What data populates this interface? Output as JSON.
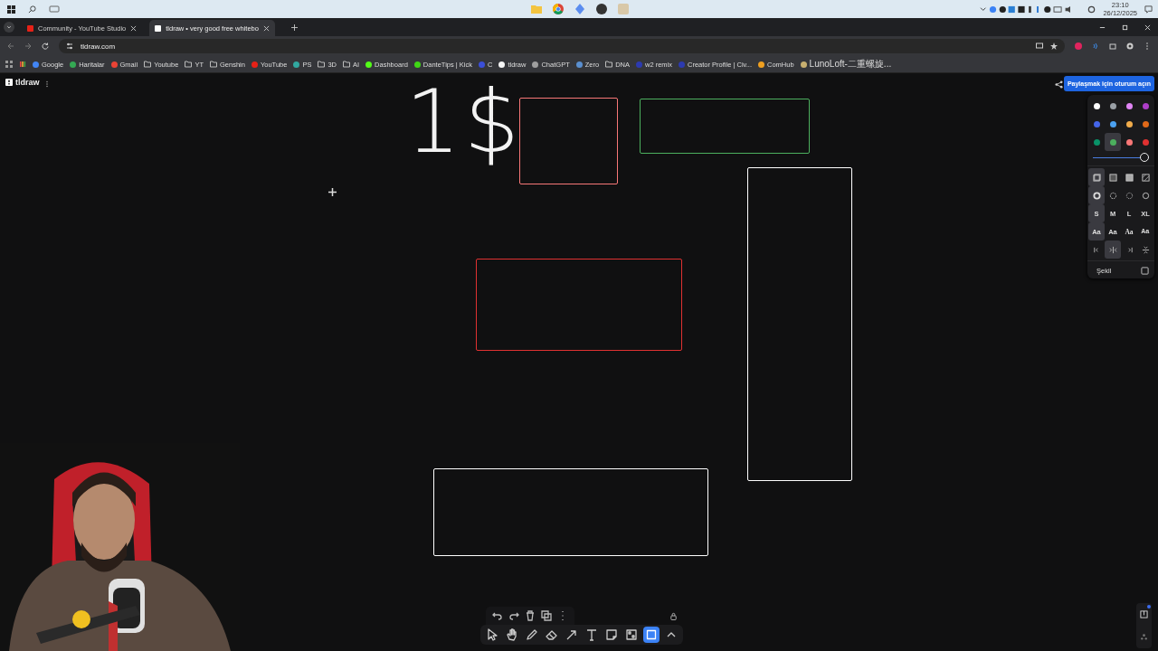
{
  "taskbar": {
    "time": "23:10",
    "date": "26/12/2025"
  },
  "tabs": [
    {
      "title": "Community - YouTube Studio",
      "color": "#e62117",
      "selected": false
    },
    {
      "title": "tldraw • very good free whitebo",
      "color": "#ffffff",
      "selected": true
    }
  ],
  "address": "tldraw.com",
  "bookmarks": [
    {
      "kind": "site",
      "label": "Google",
      "color": "#4285f4"
    },
    {
      "kind": "site",
      "label": "Haritalar",
      "color": "#34a853"
    },
    {
      "kind": "site",
      "label": "Gmail",
      "color": "#ea4335"
    },
    {
      "kind": "folder",
      "label": "Youtube"
    },
    {
      "kind": "folder",
      "label": "YT"
    },
    {
      "kind": "folder",
      "label": "Genshin"
    },
    {
      "kind": "site",
      "label": "YouTube",
      "color": "#e62117"
    },
    {
      "kind": "site",
      "label": "PS",
      "color": "#31a8a0"
    },
    {
      "kind": "folder",
      "label": "3D"
    },
    {
      "kind": "folder",
      "label": "AI"
    },
    {
      "kind": "site",
      "label": "Dashboard",
      "color": "#53fc18"
    },
    {
      "kind": "site",
      "label": "DanteTips | Kick",
      "color": "#3fd615"
    },
    {
      "kind": "site",
      "label": "C",
      "color": "#3b4fd8"
    },
    {
      "kind": "site",
      "label": "tldraw",
      "color": "#f5f5f5"
    },
    {
      "kind": "site",
      "label": "ChatGPT",
      "color": "#9e9e9e"
    },
    {
      "kind": "site",
      "label": "Zero",
      "color": "#5a8fd0"
    },
    {
      "kind": "folder",
      "label": "DNA"
    },
    {
      "kind": "site",
      "label": "w2 remix",
      "color": "#2c3ab0"
    },
    {
      "kind": "site",
      "label": "Creator Profile | Civ...",
      "color": "#2c3ab0"
    },
    {
      "kind": "site",
      "label": "ComHub",
      "color": "#f0a020"
    },
    {
      "kind": "site",
      "label": "LunoLoft-二重螺旋...",
      "color": "#c8b070"
    }
  ],
  "app": {
    "name": "tldraw",
    "share_button": "Paylaşmak için oturum açın"
  },
  "canvas": {
    "handwriting": "1$",
    "shapes": [
      {
        "color": "#f87777"
      },
      {
        "color": "#4cb05e"
      },
      {
        "color": "#ffffff"
      },
      {
        "color": "#e03131"
      },
      {
        "color": "#ffffff"
      }
    ]
  },
  "style_panel": {
    "colors": [
      {
        "color": "#ffffff",
        "selected": false
      },
      {
        "color": "#9aa0a6",
        "selected": false
      },
      {
        "color": "#e085f4",
        "selected": false
      },
      {
        "color": "#ae3ec9",
        "selected": false
      },
      {
        "color": "#4465e9",
        "selected": false
      },
      {
        "color": "#4ba1f1",
        "selected": false
      },
      {
        "color": "#f1ac4b",
        "selected": false
      },
      {
        "color": "#e16919",
        "selected": false
      },
      {
        "color": "#099268",
        "selected": false
      },
      {
        "color": "#4cb05e",
        "selected": true
      },
      {
        "color": "#f87777",
        "selected": false
      },
      {
        "color": "#e03131",
        "selected": false
      }
    ],
    "opacity": {
      "level": 1
    },
    "fills": [
      {
        "kind": "none",
        "selected": true
      },
      {
        "kind": "semi",
        "selected": false
      },
      {
        "kind": "solid",
        "selected": false
      },
      {
        "kind": "pattern",
        "selected": false
      }
    ],
    "dashes": [
      {
        "kind": "draw",
        "selected": true
      },
      {
        "kind": "dashed",
        "selected": false
      },
      {
        "kind": "dotted",
        "selected": false
      },
      {
        "kind": "solid",
        "selected": false
      }
    ],
    "sizes": [
      {
        "label": "S",
        "selected": true
      },
      {
        "label": "M",
        "selected": false
      },
      {
        "label": "L",
        "selected": false
      },
      {
        "label": "XL",
        "selected": false
      }
    ],
    "fonts": [
      {
        "label": "Aa",
        "selected": true
      },
      {
        "label": "Aa",
        "selected": false
      },
      {
        "label": "Aa",
        "selected": false
      },
      {
        "label": "Aa",
        "selected": false
      }
    ],
    "aligns": [
      {
        "kind": "start",
        "selected": false
      },
      {
        "kind": "middle",
        "selected": true
      },
      {
        "kind": "end",
        "selected": false
      },
      {
        "kind": "vertical",
        "selected": false
      }
    ],
    "shape_label": "Şekil"
  },
  "actions": [
    {
      "kind": "undo"
    },
    {
      "kind": "redo"
    },
    {
      "kind": "delete"
    },
    {
      "kind": "duplicate"
    },
    {
      "kind": "more"
    }
  ],
  "tools": [
    {
      "kind": "select",
      "selected": false
    },
    {
      "kind": "hand",
      "selected": false
    },
    {
      "kind": "draw",
      "selected": false
    },
    {
      "kind": "eraser",
      "selected": false
    },
    {
      "kind": "arrow",
      "selected": false
    },
    {
      "kind": "text",
      "selected": false
    },
    {
      "kind": "note",
      "selected": false
    },
    {
      "kind": "asset",
      "selected": false
    },
    {
      "kind": "rectangle",
      "selected": true
    },
    {
      "kind": "chevron",
      "selected": false
    }
  ]
}
